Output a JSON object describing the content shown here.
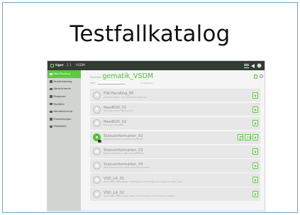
{
  "slide": {
    "title": "Testfallkatalog"
  },
  "app": {
    "brand": "tiger",
    "version": "2.1",
    "project_short": "VSDM"
  },
  "sidebar": {
    "items": [
      {
        "label": "Test-Planung",
        "icon": "test-plan-icon",
        "active": true
      },
      {
        "label": "Nutzerkatalog",
        "icon": "user-icon",
        "active": false
      },
      {
        "label": "Abrechnende",
        "icon": "chart-icon",
        "active": false
      },
      {
        "label": "Diagnose",
        "icon": "pulse-icon",
        "active": false
      },
      {
        "label": "Testfälle",
        "icon": "list-icon",
        "active": false
      },
      {
        "label": "Aktualisierung",
        "icon": "refresh-icon",
        "active": false
      },
      {
        "label": "Einstellungen",
        "icon": "gear-icon",
        "active": false
      },
      {
        "label": "Protokolle",
        "icon": "log-icon",
        "active": false
      }
    ]
  },
  "main": {
    "breadcrumb": "Testsuite",
    "project_title": "gematik_VSDM",
    "filter_label": "Filter",
    "filter_hint": "Fertigstellen"
  },
  "testcases": [
    {
      "name": "FIN-Handling_05",
      "desc": "Ablauf für Karten- oder Versicherten-Wechsel",
      "status": "idle"
    },
    {
      "name": "ReadKVK_01",
      "desc": "KVK lesen: Daten übernehmen",
      "status": "idle"
    },
    {
      "name": "ReadKVK_02",
      "desc": "KVK lesen: Fehlerfall",
      "status": "idle"
    },
    {
      "name": "Statusinformation_01",
      "desc": "Statusinformationen abrufen ohne Fehler",
      "status": "active"
    },
    {
      "name": "Statusinformation_02",
      "desc": "Statusinformationen: Warnung VSD-Status",
      "status": "idle"
    },
    {
      "name": "Statusinformation_03",
      "desc": "Statusinformationen: Karte mit Rücksetzzustand",
      "status": "idle"
    },
    {
      "name": "VSD_LA_01",
      "desc": "Versicherten-Stammdaten: Primärsystem zur Abfrage und Anzeige der Daten lesen",
      "status": "idle"
    },
    {
      "name": "VSD_LA_02",
      "desc": "Versicherten-Stammdaten: Karte nicht aktualisiert, Prüfnachweis anzeigen",
      "status": "idle"
    }
  ],
  "colors": {
    "accent": "#60c843",
    "topbar": "#333c33",
    "sidebar": "#d2d4d2",
    "frame_border": "#6fa3c9"
  }
}
